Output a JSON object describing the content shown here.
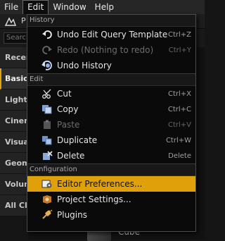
{
  "menubar": {
    "items": [
      {
        "label": "File"
      },
      {
        "label": "Edit"
      },
      {
        "label": "Window"
      },
      {
        "label": "Help"
      }
    ]
  },
  "panel": {
    "title_fragment": "P",
    "search_placeholder": "Search",
    "categories": [
      {
        "label": "Recen"
      },
      {
        "label": "Basic",
        "active": true
      },
      {
        "label": "Lights"
      },
      {
        "label": "Cinem"
      },
      {
        "label": "Visual"
      },
      {
        "label": "Geom"
      },
      {
        "label": "Volum"
      },
      {
        "label": "All Cla"
      }
    ],
    "cube_label": "Cube"
  },
  "edit_menu": {
    "history_header": "History",
    "history": [
      {
        "label": "Undo Edit Query Template",
        "shortcut": "Ctrl+Z",
        "icon": "undo-icon"
      },
      {
        "label": "Redo (Nothing to redo)",
        "shortcut": "Ctrl+Y",
        "icon": "redo-icon",
        "disabled": true
      },
      {
        "label": "Undo History",
        "shortcut": "",
        "icon": "undo-history-icon"
      }
    ],
    "edit_header": "Edit",
    "edit": [
      {
        "label": "Cut",
        "shortcut": "Ctrl+X",
        "icon": "scissors-icon"
      },
      {
        "label": "Copy",
        "shortcut": "Ctrl+C",
        "icon": "copy-icon"
      },
      {
        "label": "Paste",
        "shortcut": "Ctrl+V",
        "icon": "paste-icon",
        "disabled": true
      },
      {
        "label": "Duplicate",
        "shortcut": "Ctrl+W",
        "icon": "duplicate-icon"
      },
      {
        "label": "Delete",
        "shortcut": "Delete",
        "icon": "delete-icon"
      }
    ],
    "config_header": "Configuration",
    "config": [
      {
        "label": "Editor Preferences...",
        "icon": "preferences-icon",
        "highlighted": true
      },
      {
        "label": "Project Settings...",
        "icon": "project-settings-icon"
      },
      {
        "label": "Plugins",
        "icon": "plugins-icon"
      }
    ]
  },
  "colors": {
    "accent": "#e0a00a",
    "menu_bg": "#0a0a0a"
  }
}
